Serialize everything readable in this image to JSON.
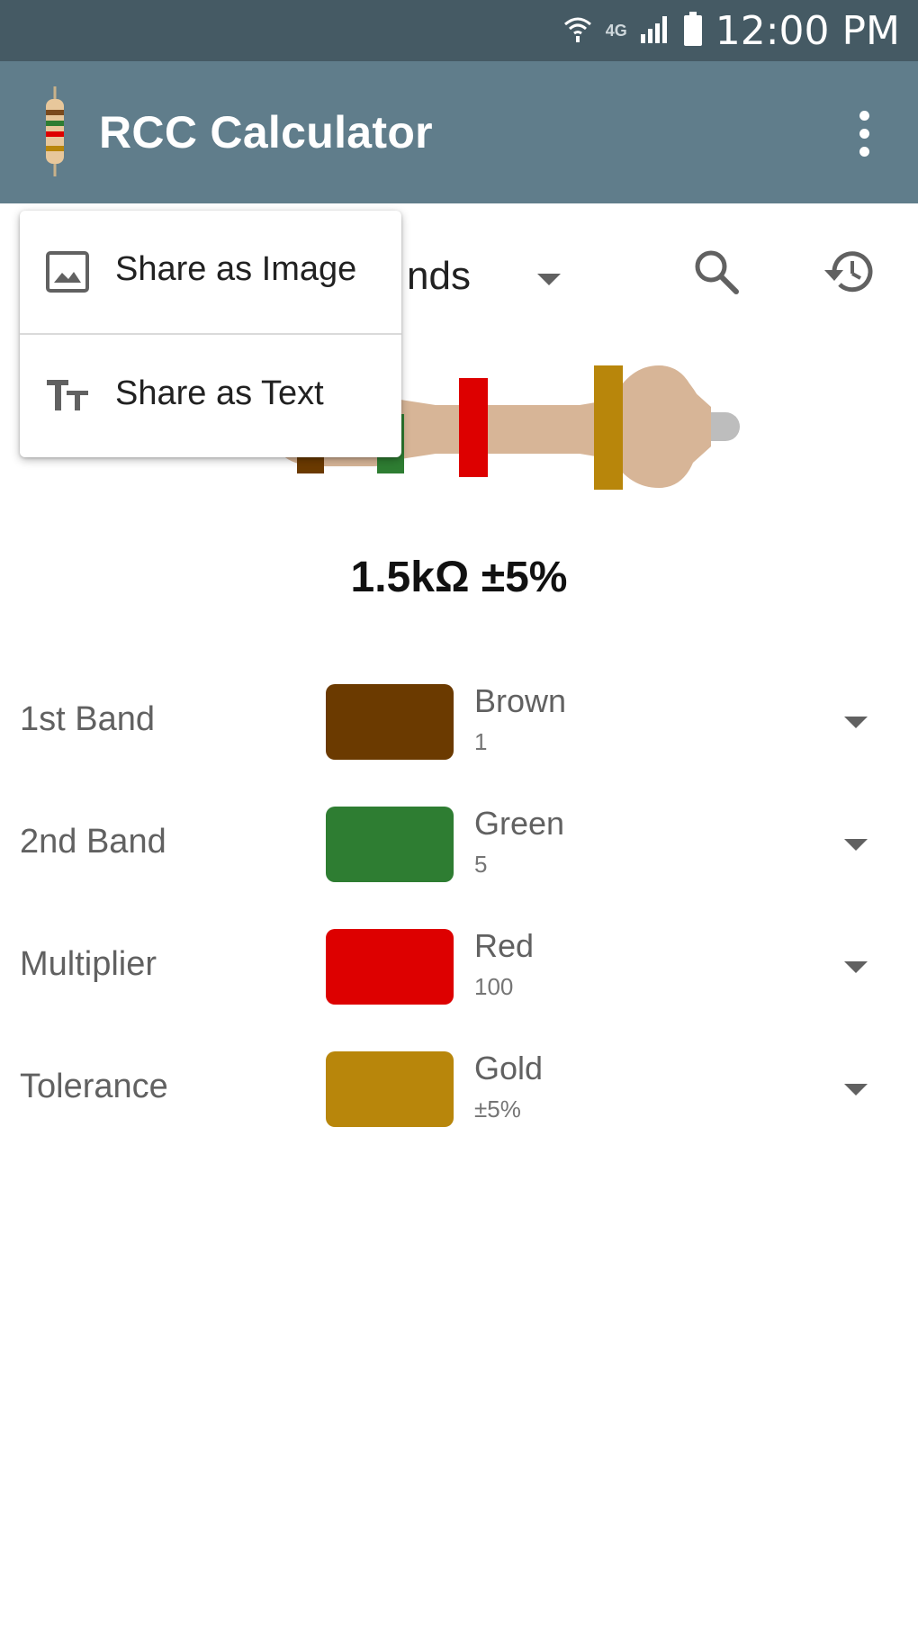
{
  "status_bar": {
    "network_label": "4G",
    "time": "12:00 PM"
  },
  "app_bar": {
    "title": "RCC Calculator",
    "logo_icon": "resistor-logo-icon",
    "overflow_icon": "more-vert-icon"
  },
  "toolbar": {
    "bands_selector_visible_text": "nds",
    "search_icon": "search-icon",
    "history_icon": "history-icon"
  },
  "resistor": {
    "band_colors": [
      "#6b3a00",
      "#2e7d32",
      "#dd0000",
      "#b8860b"
    ],
    "body_color": "#d7b597",
    "lead_color": "#bdbdbd"
  },
  "result": {
    "value": "1.5kΩ ±5%"
  },
  "bands": [
    {
      "label": "1st Band",
      "color_name": "Brown",
      "value": "1",
      "color": "#6b3a00"
    },
    {
      "label": "2nd Band",
      "color_name": "Green",
      "value": "5",
      "color": "#2e7d32"
    },
    {
      "label": "Multiplier",
      "color_name": "Red",
      "value": "100",
      "color": "#dd0000"
    },
    {
      "label": "Tolerance",
      "color_name": "Gold",
      "value": "±5%",
      "color": "#b8860b"
    }
  ],
  "share_menu": {
    "items": [
      {
        "label": "Share as Image",
        "icon": "image-icon"
      },
      {
        "label": "Share as Text",
        "icon": "text-fields-icon"
      }
    ]
  },
  "colors": {
    "status_bar": "#455a64",
    "app_bar": "#607d8b"
  }
}
